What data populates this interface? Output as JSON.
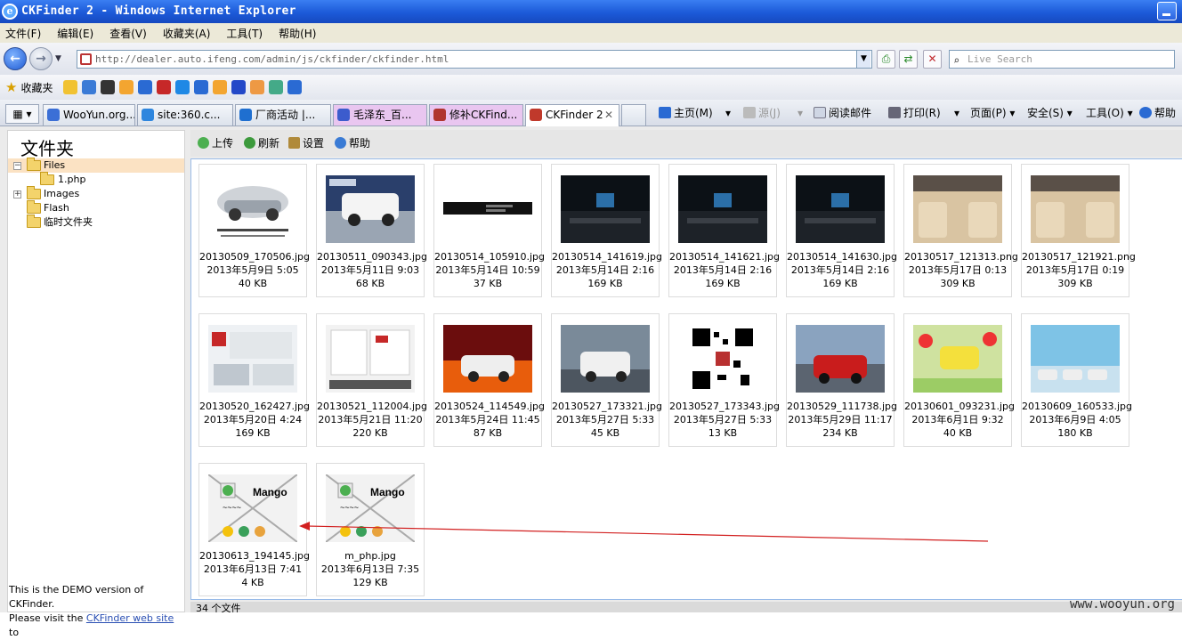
{
  "window": {
    "title": "CKFinder 2 - Windows Internet Explorer",
    "logo": "e"
  },
  "menu": [
    "文件(F)",
    "编辑(E)",
    "查看(V)",
    "收藏夹(A)",
    "工具(T)",
    "帮助(H)"
  ],
  "address": {
    "url": "http://dealer.auto.ifeng.com/admin/js/ckfinder/ckfinder.html",
    "search_placeholder": "Live Search"
  },
  "favorites": {
    "label": "收藏夹"
  },
  "tabs": [
    {
      "label": "WooYun.org...",
      "icon_color": "#3b6fd6"
    },
    {
      "label": "site:360.c...",
      "icon_color": "#2e86de"
    },
    {
      "label": "厂商活动 |...",
      "icon_color": "#1f6fd0"
    },
    {
      "label": "毛泽东_百...",
      "icon_color": "#3c5ccd"
    },
    {
      "label": "修补CKFind...",
      "icon_color": "#b0352f"
    },
    {
      "label": "CKFinder 2",
      "icon_color": "#c0392b"
    }
  ],
  "commands": {
    "home": "主页(M)",
    "feeds": "源(J)",
    "read_mail": "阅读邮件",
    "print": "打印(R)",
    "page": "页面(P)",
    "safety": "安全(S)",
    "tools": "工具(O)",
    "help": "帮助"
  },
  "finder": {
    "folders_title": "文件夹",
    "tree": [
      {
        "label": "Files",
        "expander": "−"
      },
      {
        "label": "1.php",
        "expander": ""
      },
      {
        "label": "Images",
        "expander": "+"
      },
      {
        "label": "Flash",
        "expander": ""
      },
      {
        "label": "临时文件夹",
        "expander": ""
      }
    ],
    "toolbar": {
      "upload": "上传",
      "refresh": "刷新",
      "settings": "设置",
      "help": "帮助"
    },
    "demo": {
      "line1": "This is the DEMO version of CKFinder.",
      "line2_prefix": "Please visit the ",
      "link": "CKFinder web site",
      "line2_suffix": " to"
    },
    "status": "34 个文件",
    "files": [
      {
        "name": "20130509_170506.jpg",
        "date": "2013年5月9日 5:05",
        "size": "40 KB"
      },
      {
        "name": "20130511_090343.jpg",
        "date": "2013年5月11日 9:03",
        "size": "68 KB"
      },
      {
        "name": "20130514_105910.jpg",
        "date": "2013年5月14日 10:59",
        "size": "37 KB"
      },
      {
        "name": "20130514_141619.jpg",
        "date": "2013年5月14日 2:16",
        "size": "169 KB"
      },
      {
        "name": "20130514_141621.jpg",
        "date": "2013年5月14日 2:16",
        "size": "169 KB"
      },
      {
        "name": "20130514_141630.jpg",
        "date": "2013年5月14日 2:16",
        "size": "169 KB"
      },
      {
        "name": "20130517_121313.png",
        "date": "2013年5月17日 0:13",
        "size": "309 KB"
      },
      {
        "name": "20130517_121921.png",
        "date": "2013年5月17日 0:19",
        "size": "309 KB"
      },
      {
        "name": "20130520_162427.jpg",
        "date": "2013年5月20日 4:24",
        "size": "169 KB"
      },
      {
        "name": "20130521_112004.jpg",
        "date": "2013年5月21日 11:20",
        "size": "220 KB"
      },
      {
        "name": "20130524_114549.jpg",
        "date": "2013年5月24日 11:45",
        "size": "87 KB"
      },
      {
        "name": "20130527_173321.jpg",
        "date": "2013年5月27日 5:33",
        "size": "45 KB"
      },
      {
        "name": "20130527_173343.jpg",
        "date": "2013年5月27日 5:33",
        "size": "13 KB"
      },
      {
        "name": "20130529_111738.jpg",
        "date": "2013年5月29日 11:17",
        "size": "234 KB"
      },
      {
        "name": "20130601_093231.jpg",
        "date": "2013年6月1日 9:32",
        "size": "40 KB"
      },
      {
        "name": "20130609_160533.jpg",
        "date": "2013年6月9日 4:05",
        "size": "180 KB"
      },
      {
        "name": "20130613_194145.jpg",
        "date": "2013年6月13日 7:41",
        "size": "4 KB"
      },
      {
        "name": "m_php.jpg",
        "date": "2013年6月13日 7:35",
        "size": "129 KB"
      }
    ]
  },
  "watermark": "www.wooyun.org",
  "colors": {
    "titlebar": "#1c5ad8",
    "selection": "#fbe2c3",
    "annotation_arrow": "#d22020"
  }
}
